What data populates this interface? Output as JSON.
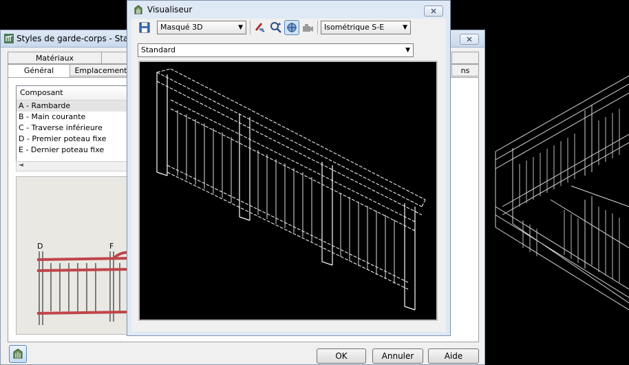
{
  "back_dialog": {
    "title": "Styles de garde-corps - Standa",
    "tabs_row1": [
      "Matériaux",
      ""
    ],
    "tabs_row2": [
      "Général",
      "Emplacement",
      "ns"
    ],
    "list": {
      "header": "Composant",
      "items": [
        "A - Rambarde",
        "B - Main courante",
        "C - Traverse inférieure",
        "D - Premier poteau fixe",
        "E - Dernier poteau fixe"
      ]
    },
    "preview_labels": {
      "d": "D",
      "f": "F"
    },
    "buttons": {
      "ok": "OK",
      "cancel": "Annuler",
      "help": "Aide"
    }
  },
  "viewer": {
    "title": "Visualiseur",
    "visual_style": "Masqué 3D",
    "view_direction": "Isométrique S-E",
    "display_config": "Standard"
  },
  "icons": [
    "app-icon",
    "close-icon",
    "save-icon",
    "orbit-icon",
    "zoom-icon",
    "pan-icon",
    "camera-icon",
    "chevron-down-icon"
  ]
}
